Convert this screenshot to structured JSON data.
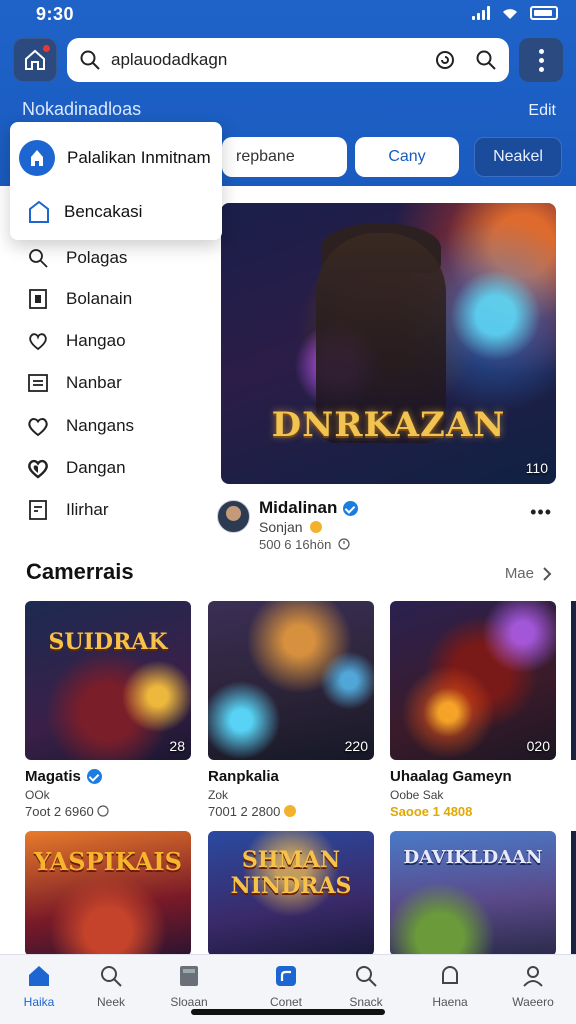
{
  "status": {
    "time": "9:30"
  },
  "search": {
    "value": "aplauodadkagn"
  },
  "header": {
    "subtitle": "Nokadinadloas",
    "edit_label": "Edit"
  },
  "chips": [
    "repbane",
    "Cany",
    "Neakel"
  ],
  "dropdown": {
    "items": [
      {
        "label": "Palalikan Inmitnam",
        "icon": "profile-avatar-icon"
      },
      {
        "label": "Bencakasi",
        "icon": "home-outline-icon"
      }
    ]
  },
  "side_menu": {
    "items": [
      {
        "label": "Polagas",
        "icon": "search-icon"
      },
      {
        "label": "Bolanain",
        "icon": "square-icon"
      },
      {
        "label": "Hangao",
        "icon": "heart-icon"
      },
      {
        "label": "Nanbar",
        "icon": "grid-icon"
      },
      {
        "label": "Nangans",
        "icon": "heart-outline-icon"
      },
      {
        "label": "Dangan",
        "icon": "heart-filled-icon"
      },
      {
        "label": "Ilirhar",
        "icon": "document-icon"
      }
    ]
  },
  "featured": {
    "title": "DNRKAZAN",
    "count": "110",
    "creator_name": "Midalinan",
    "creator_sub": "Sonjan",
    "creator_meta": "500 6 16hön"
  },
  "section": {
    "title": "Camerrais",
    "see_all": "Mae"
  },
  "cards": [
    {
      "logo": "SUIDRAK",
      "badge": "28",
      "title": "Magatis",
      "sub1": "OOk",
      "sub2": "7oot 2 6960"
    },
    {
      "logo": "",
      "badge": "220",
      "title": "Ranpkalia",
      "sub1": "Zok",
      "sub2": "7001 2 2800"
    },
    {
      "logo": "",
      "badge": "020",
      "title": "Uhaalag Gameyn",
      "sub1": "Oobe Sak",
      "sub2": "Saooe 1 4808"
    }
  ],
  "cards_row2": [
    {
      "logo": "YASPIKAIS"
    },
    {
      "logo": "SHMAN NINDRAS"
    },
    {
      "logo": "DAVIKLDAAN"
    }
  ],
  "bottom_nav": [
    {
      "label": "Haika",
      "icon": "home-icon",
      "active": true
    },
    {
      "label": "Neek",
      "icon": "search-icon",
      "active": false
    },
    {
      "label": "Sloaan",
      "icon": "library-icon",
      "active": false
    },
    {
      "label": "Conet",
      "icon": "create-icon",
      "active": false
    },
    {
      "label": "Snack",
      "icon": "search-icon",
      "active": false
    },
    {
      "label": "Haena",
      "icon": "bell-icon",
      "active": false
    },
    {
      "label": "Waeero",
      "icon": "profile-icon",
      "active": false
    }
  ],
  "colors": {
    "primary": "#1d65d0",
    "header_bg": "#1f63c9",
    "accent_gold": "#f1c452"
  }
}
